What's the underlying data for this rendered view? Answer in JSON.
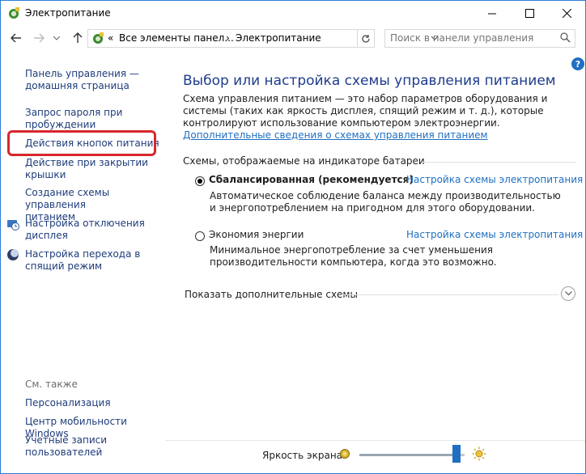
{
  "window": {
    "title": "Электропитание"
  },
  "address": {
    "overflow": "«",
    "crumb1": "Все элементы панел...",
    "separator": "›",
    "crumb2": "Электропитание"
  },
  "search": {
    "placeholder": "Поиск в панели управления"
  },
  "help": {
    "label": "?"
  },
  "sidebar": {
    "links": [
      {
        "label_line1": "Панель управления —",
        "label_line2": "домашняя страница"
      },
      {
        "label_line1": "Запрос пароля при",
        "label_line2": "пробуждении"
      },
      {
        "label_line1": "Действия кнопок питания",
        "label_line2": ""
      },
      {
        "label_line1": "Действие при закрытии",
        "label_line2": "крышки"
      },
      {
        "label_line1": "Создание схемы управления",
        "label_line2": "питанием"
      },
      {
        "label_line1": "Настройка отключения",
        "label_line2": "дисплея"
      },
      {
        "label_line1": "Настройка перехода в",
        "label_line2": "спящий режим"
      }
    ],
    "see_also": "См. также",
    "see_also_links": [
      {
        "label_line1": "Персонализация",
        "label_line2": ""
      },
      {
        "label_line1": "Центр мобильности Windows",
        "label_line2": ""
      },
      {
        "label_line1": "Учетные записи",
        "label_line2": "пользователей"
      }
    ]
  },
  "main": {
    "heading": "Выбор или настройка схемы управления питанием",
    "intro_text": "Схема управления питанием — это набор параметров оборудования и системы (таких как яркость дисплея, спящий режим и т. д.), которые контролируют использование компьютером электроэнергии. ",
    "intro_link": "Дополнительные сведения о схемах управления питанием",
    "group_label": "Схемы, отображаемые на индикаторе батареи",
    "plans": [
      {
        "name": "Сбалансированная (рекомендуется)",
        "selected": true,
        "link": "Настройка схемы электропитания",
        "desc": "Автоматическое соблюдение баланса между производительностью и энергопотреблением на пригодном для этого оборудовании."
      },
      {
        "name": "Экономия энергии",
        "selected": false,
        "link": "Настройка схемы электропитания",
        "desc": "Минимальное энергопотребление за счет уменьшения производительности компьютера, когда это возможно."
      }
    ],
    "more_schemes": "Показать дополнительные схемы"
  },
  "brightness": {
    "label": "Яркость экрана:",
    "value_percent": 96,
    "accent": "#1f6fc2"
  }
}
